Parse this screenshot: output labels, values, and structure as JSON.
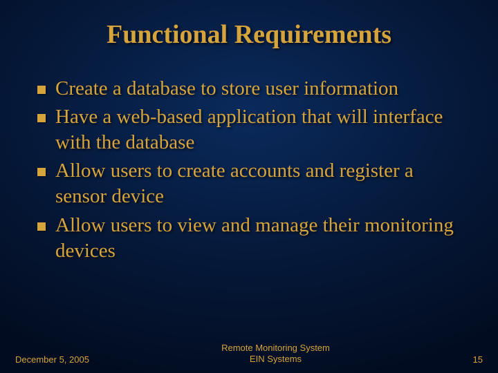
{
  "title": "Functional Requirements",
  "bullets": {
    "b0": "Create a database to store user information",
    "b1": "Have a web-based application that will interface with the database",
    "b2": "Allow users to create accounts and register a sensor device",
    "b3": "Allow users to view and manage their monitoring devices"
  },
  "footer": {
    "date": "December 5, 2005",
    "center_line1": "Remote Monitoring System",
    "center_line2": "EIN Systems",
    "page": "15"
  }
}
